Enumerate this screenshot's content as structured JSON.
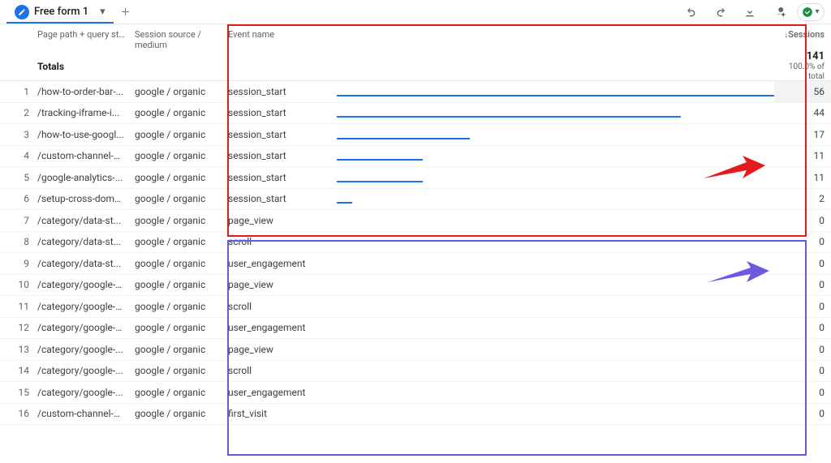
{
  "toolbar": {
    "tab_label": "Free form 1",
    "icons": {
      "undo": "undo-icon",
      "redo": "redo-icon",
      "download": "download-icon",
      "share": "share-icon",
      "status_ok": "status-ok-icon"
    }
  },
  "headers": {
    "path": "Page path + query string",
    "source": "Session source / medium",
    "event": "Event name",
    "sessions": "Sessions",
    "sort_indicator": "↓"
  },
  "totals": {
    "label": "Totals",
    "value": "141",
    "subtext": "100.0% of total"
  },
  "max_value": 56,
  "rows": [
    {
      "idx": 1,
      "path": "/how-to-order-bar-...",
      "source": "google / organic",
      "event": "session_start",
      "value": 56
    },
    {
      "idx": 2,
      "path": "/tracking-iframe-i...",
      "source": "google / organic",
      "event": "session_start",
      "value": 44
    },
    {
      "idx": 3,
      "path": "/how-to-use-googl...",
      "source": "google / organic",
      "event": "session_start",
      "value": 17
    },
    {
      "idx": 4,
      "path": "/custom-channel-g...",
      "source": "google / organic",
      "event": "session_start",
      "value": 11
    },
    {
      "idx": 5,
      "path": "/google-analytics-...",
      "source": "google / organic",
      "event": "session_start",
      "value": 11
    },
    {
      "idx": 6,
      "path": "/setup-cross-domai...",
      "source": "google / organic",
      "event": "session_start",
      "value": 2
    },
    {
      "idx": 7,
      "path": "/category/data-st...",
      "source": "google / organic",
      "event": "page_view",
      "value": 0
    },
    {
      "idx": 8,
      "path": "/category/data-st...",
      "source": "google / organic",
      "event": "scroll",
      "value": 0
    },
    {
      "idx": 9,
      "path": "/category/data-st...",
      "source": "google / organic",
      "event": "user_engagement",
      "value": 0
    },
    {
      "idx": 10,
      "path": "/category/google-a...",
      "source": "google / organic",
      "event": "page_view",
      "value": 0
    },
    {
      "idx": 11,
      "path": "/category/google-a...",
      "source": "google / organic",
      "event": "scroll",
      "value": 0
    },
    {
      "idx": 12,
      "path": "/category/google-a...",
      "source": "google / organic",
      "event": "user_engagement",
      "value": 0
    },
    {
      "idx": 13,
      "path": "/category/google-...",
      "source": "google / organic",
      "event": "page_view",
      "value": 0
    },
    {
      "idx": 14,
      "path": "/category/google-...",
      "source": "google / organic",
      "event": "scroll",
      "value": 0
    },
    {
      "idx": 15,
      "path": "/category/google-...",
      "source": "google / organic",
      "event": "user_engagement",
      "value": 0
    },
    {
      "idx": 16,
      "path": "/custom-channel-g...",
      "source": "google / organic",
      "event": "first_visit",
      "value": 0
    }
  ]
}
